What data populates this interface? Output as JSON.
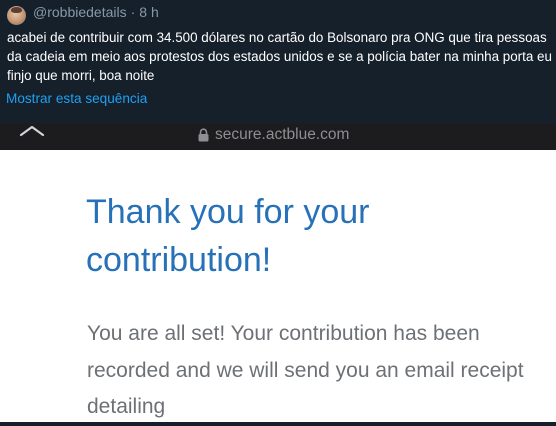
{
  "tweet": {
    "handle": "@robbiedetails",
    "separator": "·",
    "time": "8 h",
    "text": "acabei de contribuir com 34.500 dólares no cartão do Bolsonaro pra ONG que tira pessoas da cadeia em meio aos protestos dos estados unidos e se a polícia bater na minha porta eu finjo que morri, boa noite",
    "show_thread": "Mostrar esta sequência"
  },
  "browser": {
    "url": "secure.actblue.com",
    "back_icon": "chevron-up-icon",
    "lock_icon": "lock-icon"
  },
  "page": {
    "title": "Thank you for your contribution!",
    "body": "You are all set! Your contribution has been recorded and we will send you an email receipt detailing"
  },
  "colors": {
    "tweet_bg": "#15202b",
    "link": "#1da1f2",
    "title": "#2771b8",
    "body": "#6d7175"
  }
}
